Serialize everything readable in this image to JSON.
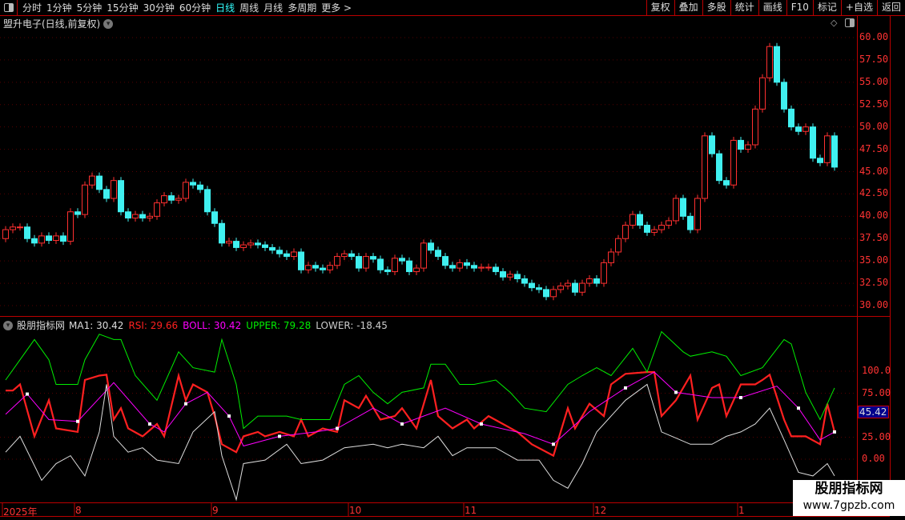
{
  "toolbar": {
    "periods": [
      "分时",
      "1分钟",
      "5分钟",
      "15分钟",
      "30分钟",
      "60分钟",
      "日线",
      "周线",
      "月线",
      "多周期",
      "更多 >"
    ],
    "active_period": "日线",
    "right_buttons": [
      "复权",
      "叠加",
      "多股",
      "统计",
      "画线",
      "F10",
      "标记",
      "+自选",
      "返回"
    ]
  },
  "main": {
    "title": "盟升电子(日线,前复权)",
    "title_icon": "chevron-down-icon"
  },
  "colors": {
    "up": "#ff3030",
    "down": "#40f0f0",
    "rsi": "#ff2020",
    "boll": "#ff00ff",
    "upper": "#00ee00",
    "lower": "#dddddd",
    "axis": "#bb0000"
  },
  "indicator": {
    "name": "股朋指标网",
    "labels": [
      {
        "text": "MA1: 30.42",
        "color": "#dddddd"
      },
      {
        "text": "RSI: 29.66",
        "color": "#ff2020"
      },
      {
        "text": "BOLL: 30.42",
        "color": "#ff00ff"
      },
      {
        "text": "UPPER: 79.28",
        "color": "#00ee00"
      },
      {
        "text": "LOWER: -18.45",
        "color": "#cccccc"
      }
    ],
    "current_value": "45.42",
    "axis_ticks": [
      "100.0",
      "75.00",
      "25.00",
      "0.00"
    ]
  },
  "watermark": {
    "line1": "股朋指标网",
    "line2": "www.7gpzb.com"
  },
  "chart_data": [
    {
      "type": "candlestick",
      "ylim": [
        30,
        60
      ],
      "yticks": [
        "60.00",
        "57.50",
        "55.00",
        "52.50",
        "50.00",
        "47.50",
        "45.00",
        "42.50",
        "40.00",
        "37.50",
        "35.00",
        "32.50",
        "30.00"
      ],
      "first_open": 37.5,
      "close": [
        38.5,
        38.8,
        38.8,
        37.5,
        37.0,
        37.8,
        37.3,
        37.8,
        37.2,
        40.5,
        40.2,
        43.5,
        44.5,
        43.0,
        42.0,
        44.0,
        40.5,
        39.8,
        40.2,
        39.8,
        40.0,
        41.5,
        42.3,
        41.8,
        42.0,
        43.8,
        43.5,
        43.0,
        40.5,
        39.2,
        37.0,
        37.2,
        36.5,
        36.8,
        37.0,
        36.8,
        36.5,
        36.2,
        35.8,
        35.5,
        36.0,
        34.0,
        34.5,
        34.2,
        34.0,
        34.5,
        35.5,
        35.8,
        35.5,
        34.2,
        35.5,
        35.2,
        34.0,
        33.8,
        35.3,
        35.0,
        33.8,
        34.2,
        37.0,
        36.2,
        35.5,
        34.5,
        34.2,
        34.8,
        34.5,
        34.2,
        34.3,
        34.3,
        33.8,
        33.2,
        33.5,
        33.0,
        32.5,
        32.0,
        31.8,
        31.0,
        31.8,
        32.2,
        32.5,
        31.5,
        32.5,
        33.0,
        32.5,
        34.8,
        36.0,
        37.5,
        39.0,
        40.2,
        39.0,
        38.2,
        38.5,
        39.0,
        39.5,
        42.0,
        40.0,
        38.5,
        42.0,
        49.0,
        47.0,
        44.0,
        43.5,
        48.5,
        47.5,
        48.0,
        52.0,
        55.5,
        59.0,
        55.0,
        52.0,
        50.0,
        49.5,
        50.0,
        46.5,
        46.0,
        49.0,
        45.5
      ],
      "date_labels": [
        {
          "label": "2025年",
          "bar": 0
        },
        {
          "label": "8",
          "bar": 10
        },
        {
          "label": "9",
          "bar": 29
        },
        {
          "label": "10",
          "bar": 48
        },
        {
          "label": "11",
          "bar": 64
        },
        {
          "label": "12",
          "bar": 82
        },
        {
          "label": "1",
          "bar": 102
        }
      ]
    },
    {
      "type": "line",
      "ylim": [
        -50,
        150
      ],
      "series": [
        {
          "name": "RSI",
          "color": "#ff2020",
          "points": [
            [
              0,
              78
            ],
            [
              1,
              78
            ],
            [
              2,
              85
            ],
            [
              4,
              26
            ],
            [
              6,
              67
            ],
            [
              7,
              35
            ],
            [
              10,
              31
            ],
            [
              11,
              90
            ],
            [
              13,
              95
            ],
            [
              14,
              96
            ],
            [
              15,
              45
            ],
            [
              16,
              58
            ],
            [
              17,
              35
            ],
            [
              19,
              26
            ],
            [
              21,
              40
            ],
            [
              22,
              26
            ],
            [
              24,
              95
            ],
            [
              25,
              67
            ],
            [
              26,
              85
            ],
            [
              28,
              76
            ],
            [
              29,
              49
            ],
            [
              30,
              17
            ],
            [
              32,
              8
            ],
            [
              33,
              26
            ],
            [
              35,
              31
            ],
            [
              36,
              26
            ],
            [
              38,
              31
            ],
            [
              40,
              26
            ],
            [
              41,
              45
            ],
            [
              42,
              26
            ],
            [
              44,
              35
            ],
            [
              46,
              31
            ],
            [
              47,
              67
            ],
            [
              49,
              58
            ],
            [
              50,
              72
            ],
            [
              52,
              45
            ],
            [
              54,
              49
            ],
            [
              55,
              58
            ],
            [
              57,
              35
            ],
            [
              59,
              90
            ],
            [
              60,
              49
            ],
            [
              62,
              35
            ],
            [
              64,
              45
            ],
            [
              65,
              35
            ],
            [
              67,
              49
            ],
            [
              69,
              40
            ],
            [
              71,
              31
            ],
            [
              73,
              17
            ],
            [
              76,
              4
            ],
            [
              78,
              58
            ],
            [
              79,
              35
            ],
            [
              81,
              63
            ],
            [
              83,
              49
            ],
            [
              84,
              85
            ],
            [
              86,
              97
            ],
            [
              89,
              99
            ],
            [
              90,
              99
            ],
            [
              91,
              49
            ],
            [
              93,
              67
            ],
            [
              95,
              95
            ],
            [
              96,
              45
            ],
            [
              98,
              81
            ],
            [
              99,
              85
            ],
            [
              100,
              49
            ],
            [
              102,
              85
            ],
            [
              104,
              85
            ],
            [
              105,
              90
            ],
            [
              106,
              96
            ],
            [
              108,
              45
            ],
            [
              109,
              26
            ],
            [
              111,
              26
            ],
            [
              113,
              17
            ],
            [
              114,
              63
            ],
            [
              115,
              31
            ]
          ]
        },
        {
          "name": "BOLL",
          "color": "#ff00ff",
          "points": [
            [
              0,
              51
            ],
            [
              3,
              74
            ],
            [
              6,
              45
            ],
            [
              10,
              43
            ],
            [
              15,
              87
            ],
            [
              20,
              40
            ],
            [
              22,
              31
            ],
            [
              25,
              63
            ],
            [
              28,
              76
            ],
            [
              31,
              49
            ],
            [
              33,
              15
            ],
            [
              38,
              26
            ],
            [
              43,
              31
            ],
            [
              46,
              35
            ],
            [
              51,
              58
            ],
            [
              55,
              40
            ],
            [
              61,
              58
            ],
            [
              66,
              40
            ],
            [
              72,
              29
            ],
            [
              76,
              17
            ],
            [
              81,
              54
            ],
            [
              86,
              81
            ],
            [
              90,
              99
            ],
            [
              93,
              76
            ],
            [
              98,
              70
            ],
            [
              102,
              70
            ],
            [
              107,
              83
            ],
            [
              110,
              58
            ],
            [
              113,
              22
            ],
            [
              115,
              31
            ]
          ]
        },
        {
          "name": "UPPER",
          "color": "#00ee00",
          "points": [
            [
              0,
              90
            ],
            [
              2,
              113
            ],
            [
              4,
              136
            ],
            [
              6,
              113
            ],
            [
              7,
              85
            ],
            [
              10,
              85
            ],
            [
              11,
              113
            ],
            [
              13,
              142
            ],
            [
              15,
              136
            ],
            [
              16,
              136
            ],
            [
              18,
              95
            ],
            [
              21,
              67
            ],
            [
              24,
              122
            ],
            [
              26,
              104
            ],
            [
              29,
              99
            ],
            [
              30,
              136
            ],
            [
              32,
              85
            ],
            [
              33,
              35
            ],
            [
              35,
              49
            ],
            [
              39,
              49
            ],
            [
              41,
              45
            ],
            [
              45,
              45
            ],
            [
              47,
              85
            ],
            [
              49,
              95
            ],
            [
              51,
              76
            ],
            [
              53,
              63
            ],
            [
              55,
              76
            ],
            [
              58,
              81
            ],
            [
              59,
              108
            ],
            [
              61,
              108
            ],
            [
              63,
              85
            ],
            [
              65,
              85
            ],
            [
              68,
              90
            ],
            [
              70,
              76
            ],
            [
              72,
              58
            ],
            [
              75,
              54
            ],
            [
              78,
              85
            ],
            [
              80,
              95
            ],
            [
              82,
              104
            ],
            [
              84,
              95
            ],
            [
              87,
              126
            ],
            [
              89,
              99
            ],
            [
              91,
              145
            ],
            [
              94,
              122
            ],
            [
              95,
              117
            ],
            [
              98,
              122
            ],
            [
              100,
              117
            ],
            [
              102,
              95
            ],
            [
              105,
              104
            ],
            [
              108,
              136
            ],
            [
              109,
              131
            ],
            [
              111,
              76
            ],
            [
              113,
              45
            ],
            [
              115,
              81
            ]
          ]
        },
        {
          "name": "LOWER",
          "color": "#dddddd",
          "points": [
            [
              0,
              8
            ],
            [
              2,
              26
            ],
            [
              5,
              -24
            ],
            [
              7,
              -5
            ],
            [
              9,
              4
            ],
            [
              11,
              -19
            ],
            [
              13,
              31
            ],
            [
              14,
              85
            ],
            [
              15,
              26
            ],
            [
              17,
              8
            ],
            [
              19,
              13
            ],
            [
              21,
              -1
            ],
            [
              24,
              -5
            ],
            [
              26,
              31
            ],
            [
              29,
              54
            ],
            [
              30,
              4
            ],
            [
              32,
              -46
            ],
            [
              33,
              -5
            ],
            [
              36,
              -1
            ],
            [
              39,
              17
            ],
            [
              41,
              -5
            ],
            [
              44,
              -1
            ],
            [
              47,
              13
            ],
            [
              51,
              17
            ],
            [
              53,
              13
            ],
            [
              55,
              17
            ],
            [
              58,
              13
            ],
            [
              60,
              26
            ],
            [
              62,
              4
            ],
            [
              64,
              13
            ],
            [
              68,
              13
            ],
            [
              71,
              -1
            ],
            [
              74,
              -1
            ],
            [
              76,
              -24
            ],
            [
              78,
              -33
            ],
            [
              80,
              -5
            ],
            [
              82,
              31
            ],
            [
              84,
              49
            ],
            [
              86,
              67
            ],
            [
              89,
              85
            ],
            [
              91,
              31
            ],
            [
              93,
              24
            ],
            [
              95,
              17
            ],
            [
              98,
              17
            ],
            [
              100,
              26
            ],
            [
              102,
              31
            ],
            [
              104,
              40
            ],
            [
              106,
              58
            ],
            [
              108,
              22
            ],
            [
              110,
              -15
            ],
            [
              112,
              -19
            ],
            [
              114,
              -5
            ],
            [
              115,
              -19
            ]
          ]
        }
      ],
      "markers_on": "BOLL"
    }
  ]
}
